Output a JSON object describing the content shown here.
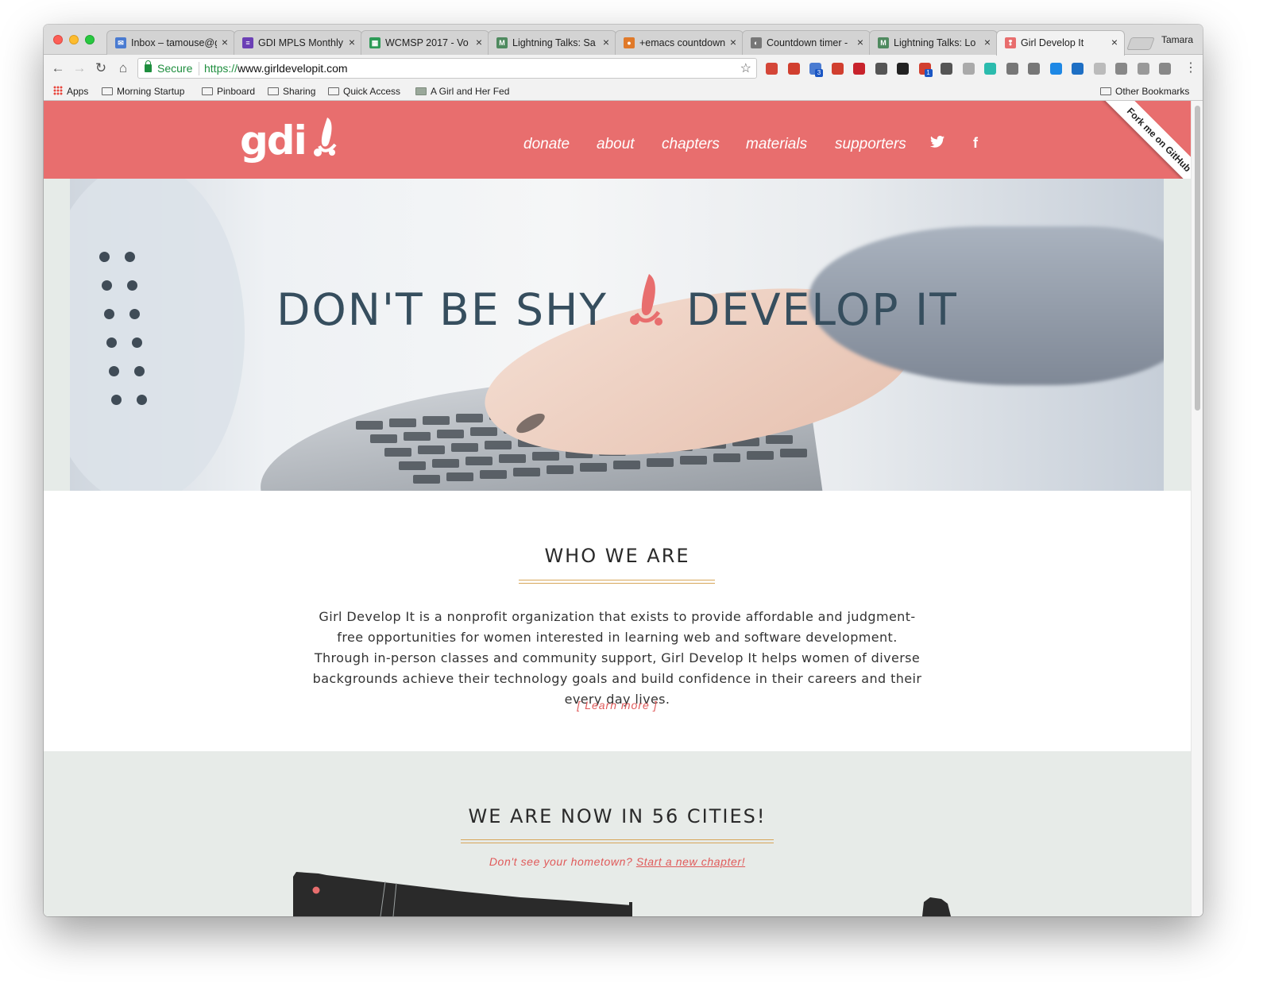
{
  "browser": {
    "tabs": [
      {
        "title": "Inbox – tamouse@g",
        "icon_color": "#4a7bd1",
        "icon_glyph": "✉"
      },
      {
        "title": "GDI MPLS Monthly",
        "icon_color": "#6b3fb5",
        "icon_glyph": "≡"
      },
      {
        "title": "WCMSP 2017 - Vo",
        "icon_color": "#2e9b57",
        "icon_glyph": "▦"
      },
      {
        "title": "Lightning Talks: Sa",
        "icon_color": "#4f8a5f",
        "icon_glyph": "M"
      },
      {
        "title": "+emacs countdown",
        "icon_color": "#e07a2a",
        "icon_glyph": "●"
      },
      {
        "title": "Countdown timer -",
        "icon_color": "#777777",
        "icon_glyph": "◐"
      },
      {
        "title": "Lightning Talks: Lo",
        "icon_color": "#4f8a5f",
        "icon_glyph": "M"
      },
      {
        "title": "Girl Develop It",
        "icon_color": "#e86e6e",
        "icon_glyph": "❢",
        "active": true
      }
    ],
    "profile_name": "Tamara",
    "omnibox": {
      "secure_label": "Secure",
      "url_scheme": "https://",
      "url_host": "www.girldevelopit.com"
    },
    "bookmarks": [
      "Apps",
      "Morning Startup",
      "Pinboard",
      "Sharing",
      "Quick Access",
      "A Girl and Her Fed",
      "Other Bookmarks"
    ],
    "extension_badges": {
      "calendar": "3",
      "heart": "1"
    },
    "extension_colors": [
      "#d44638",
      "#d13f2f",
      "#4a7bd1",
      "#d13f2f",
      "#c8232c",
      "#555555",
      "#222222",
      "#d13f2f",
      "#555555",
      "#aaaaaa",
      "#2bbbad",
      "#777777",
      "#777777",
      "#1e88e5",
      "#1e6fc4",
      "#bbbbbb",
      "#888888",
      "#999999",
      "#888888"
    ]
  },
  "site": {
    "logo_text": "gdi",
    "nav": [
      "donate",
      "about",
      "chapters",
      "materials",
      "supporters"
    ],
    "social": {
      "twitter_glyph": "🐦",
      "facebook_glyph": "f"
    },
    "ribbon": "Fork me on GitHub",
    "hero": {
      "left_text": "DON'T BE SHY",
      "right_text": "DEVELOP IT"
    },
    "who": {
      "heading": "WHO WE ARE",
      "body": "Girl Develop It is a nonprofit organization that exists to provide affordable and judgment-free opportunities for women interested in learning web and software development. Through in-person classes and community support, Girl Develop It helps women of diverse backgrounds achieve their technology goals and build confidence in their careers and their every day lives.",
      "learn_more": "[ Learn more ]"
    },
    "cities": {
      "heading": "WE ARE NOW IN 56 CITIES!",
      "sub_text": "Don't see your hometown?",
      "sub_link": "Start a new chapter!"
    },
    "colors": {
      "brand": "#e86e6e",
      "heading": "#364e5e",
      "accent_rule": "#d7a65a",
      "link": "#e05a5a"
    }
  }
}
